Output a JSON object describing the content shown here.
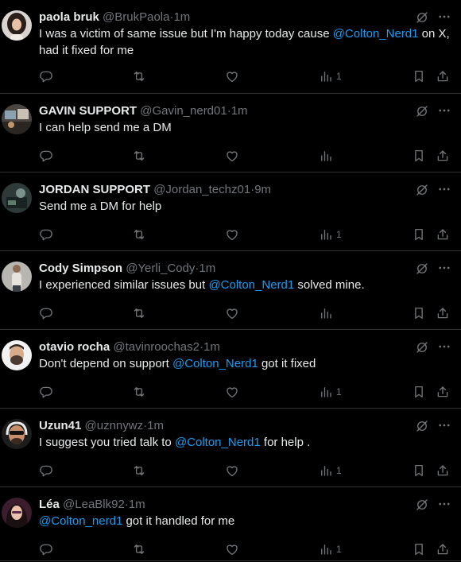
{
  "colors": {
    "background": "#000000",
    "text": "#e7e9ea",
    "muted": "#71767b",
    "link": "#1d9bf0",
    "divider": "#2f3336"
  },
  "posts": [
    {
      "display_name": "paola bruk",
      "handle": "@BrukPaola",
      "separator": "·",
      "time": "1m",
      "text_parts": [
        {
          "t": "I was a victim of same issue but I'm happy today cause ",
          "m": false
        },
        {
          "t": "@Colton_Nerd1",
          "m": true
        },
        {
          "t": " on X, had it fixed for me",
          "m": false
        }
      ],
      "views": "1",
      "avatar": "woman-dark-hair-avatar"
    },
    {
      "display_name": "GAVIN SUPPORT",
      "handle": "@Gavin_nerd01",
      "separator": "·",
      "time": "1m",
      "text_parts": [
        {
          "t": "I can help send me a DM",
          "m": false
        }
      ],
      "views": "",
      "avatar": "desk-workstation-avatar"
    },
    {
      "display_name": "JORDAN SUPPORT",
      "handle": "@Jordan_techz01",
      "separator": "·",
      "time": "9m",
      "text_parts": [
        {
          "t": "Send me a DM for help",
          "m": false
        }
      ],
      "views": "1",
      "avatar": "computer-repair-avatar"
    },
    {
      "display_name": "Cody Simpson",
      "handle": "@Yerli_Cody",
      "separator": "·",
      "time": "1m",
      "text_parts": [
        {
          "t": "I experienced similar issues but  ",
          "m": false
        },
        {
          "t": "@Colton_Nerd1",
          "m": true
        },
        {
          "t": " solved mine.",
          "m": false
        }
      ],
      "views": "",
      "avatar": "man-standing-avatar"
    },
    {
      "display_name": "otavio rocha",
      "handle": "@tavinroochas2",
      "separator": "·",
      "time": "1m",
      "text_parts": [
        {
          "t": "Don't depend on support ",
          "m": false
        },
        {
          "t": "@Colton_Nerd1",
          "m": true
        },
        {
          "t": " got it fixed",
          "m": false
        }
      ],
      "views": "1",
      "avatar": "man-beard-avatar"
    },
    {
      "display_name": "Uzun41",
      "handle": "@uznnywz",
      "separator": "·",
      "time": "1m",
      "text_parts": [
        {
          "t": "I suggest you tried talk to  ",
          "m": false
        },
        {
          "t": "@Colton_Nerd1",
          "m": true
        },
        {
          "t": " for help .",
          "m": false
        }
      ],
      "views": "1",
      "avatar": "man-sunglasses-headset-avatar"
    },
    {
      "display_name": "Léa",
      "handle": "@LeaBlk92",
      "separator": "·",
      "time": "1m",
      "text_parts": [
        {
          "t": "@Colton_nerd1",
          "m": true
        },
        {
          "t": " got it handled for me",
          "m": false
        }
      ],
      "views": "1",
      "avatar": "woman-long-hair-avatar"
    }
  ]
}
